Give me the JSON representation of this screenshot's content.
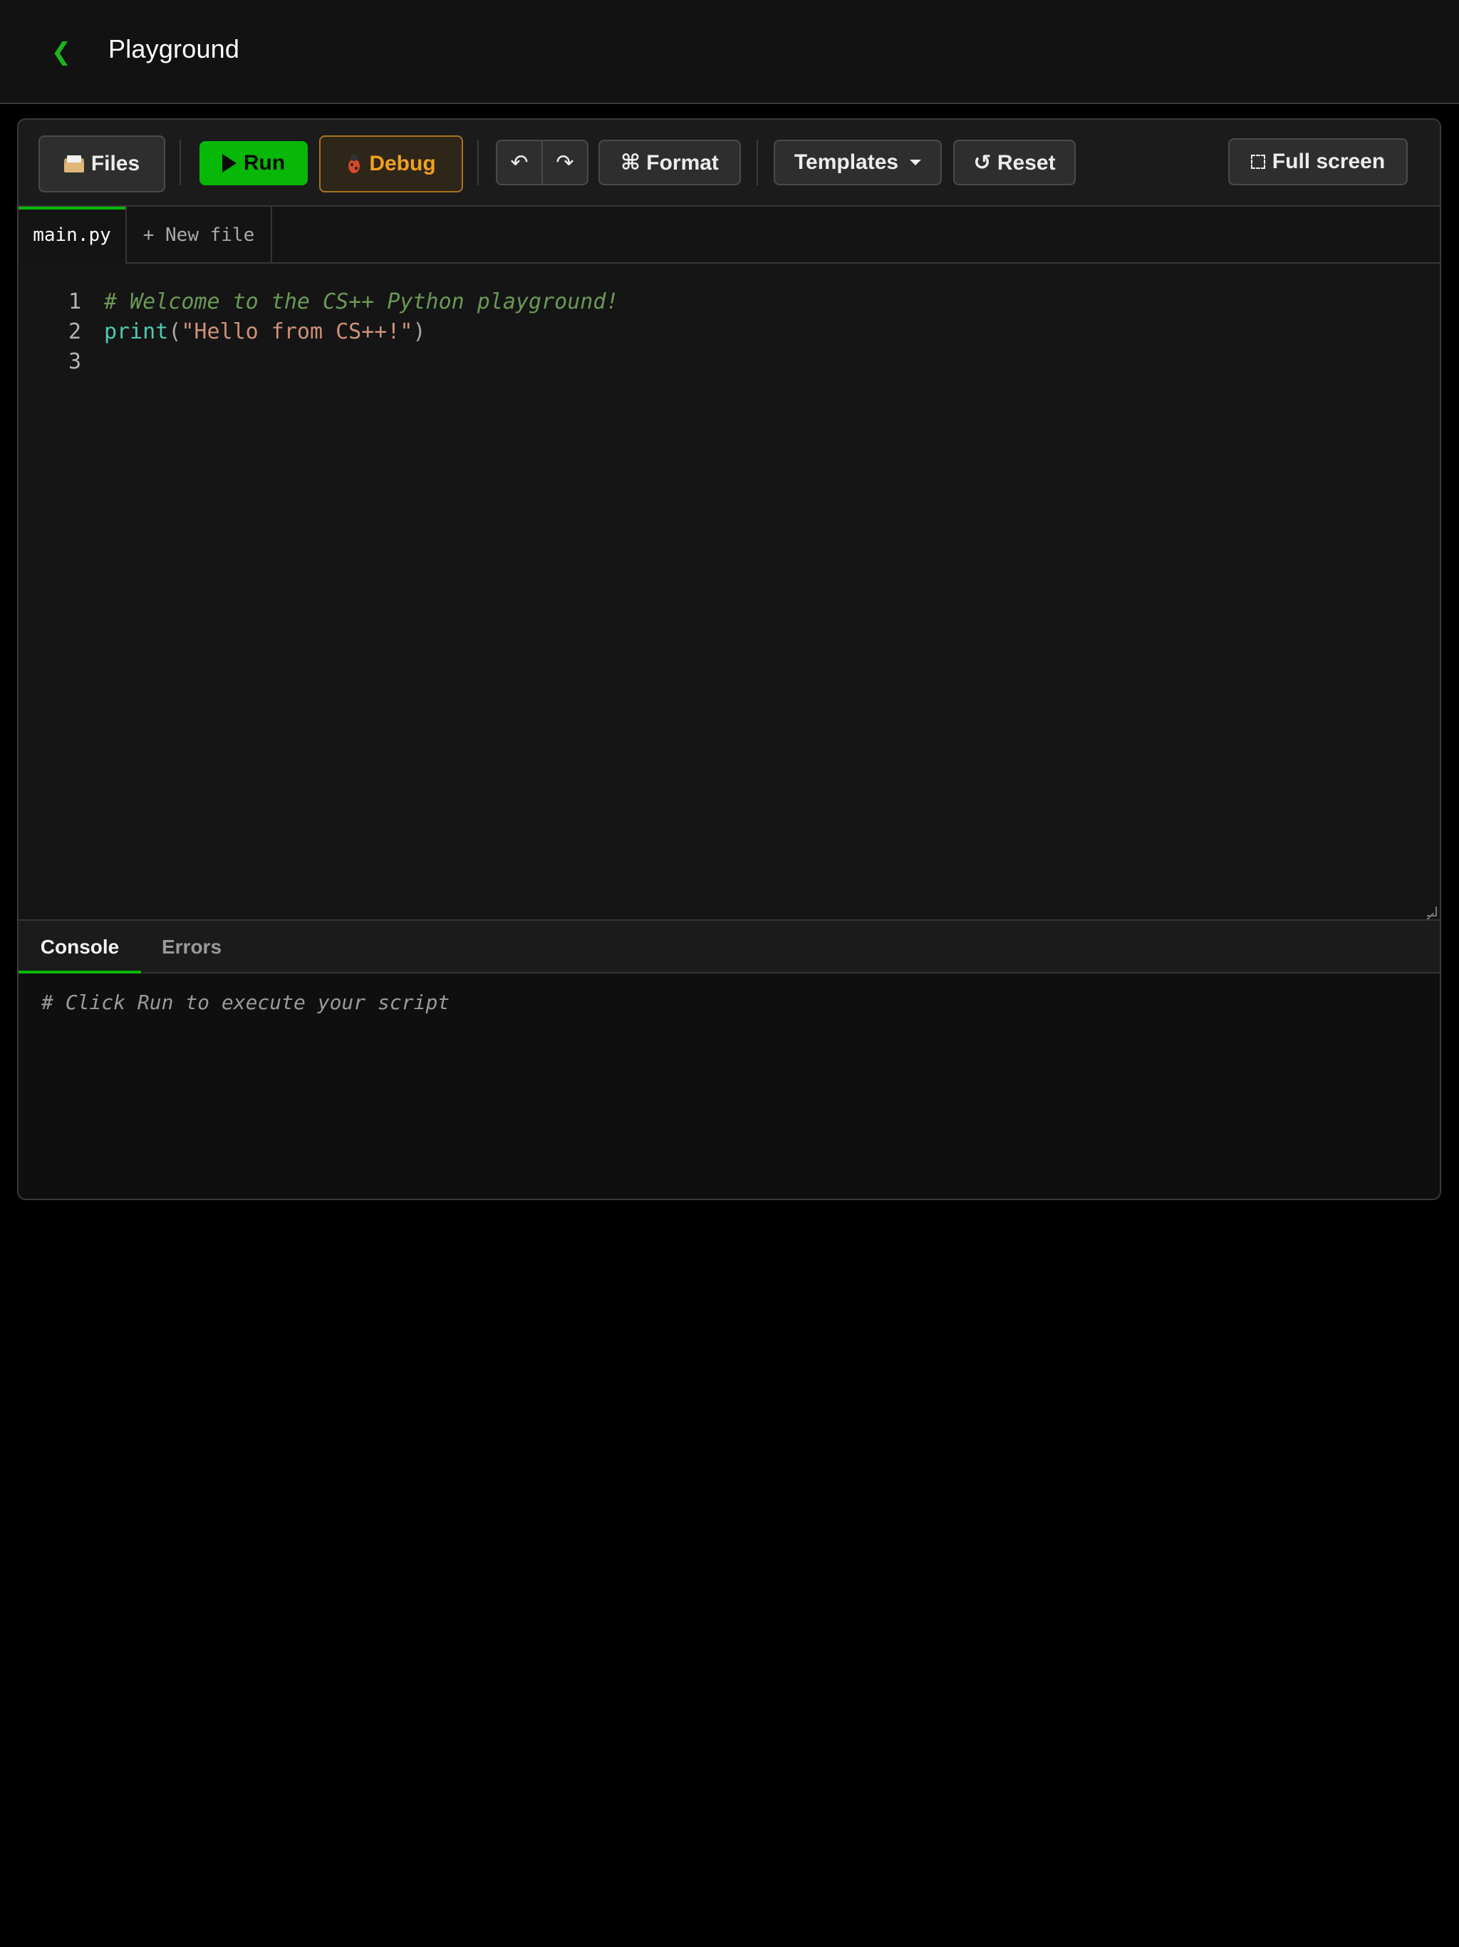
{
  "header": {
    "back_icon": "chevron-left-icon",
    "back_glyph": "❮",
    "title": "Playground"
  },
  "toolbar": {
    "files_label": "Files",
    "run_label": "Run",
    "debug_label": "Debug",
    "undo_glyph": "↶",
    "redo_glyph": "↷",
    "format_label": "⌘ Format",
    "templates_label": "Templates",
    "reset_label": "↺ Reset",
    "fullscreen_label": "Full screen"
  },
  "file_tabs": [
    {
      "label": "main.py",
      "active": true
    },
    {
      "label": "+ New file",
      "active": false
    }
  ],
  "editor": {
    "lines": [
      {
        "number": "1",
        "comment": "# Welcome to the CS++ Python playground!"
      },
      {
        "number": "2",
        "fn": "print",
        "open": "(",
        "str": "\"Hello from CS++!\"",
        "close": ")"
      },
      {
        "number": "3"
      }
    ]
  },
  "console": {
    "tabs": [
      {
        "label": "Console",
        "active": true
      },
      {
        "label": "Errors",
        "active": false
      }
    ],
    "placeholder": "# Click Run to execute your script"
  },
  "colors": {
    "accent": "#08b808",
    "debug": "#f0a020",
    "background": "#000000",
    "surface": "#141414"
  }
}
